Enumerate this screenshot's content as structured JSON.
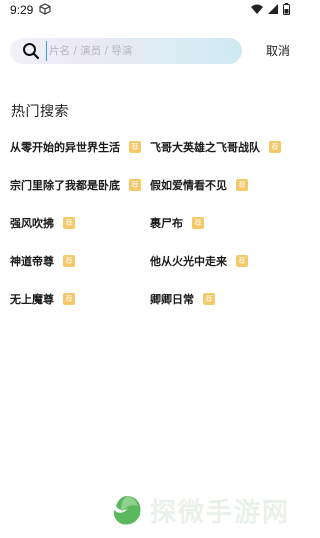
{
  "status_bar": {
    "time": "9:29",
    "icons": [
      "app-cube-icon",
      "wifi-icon",
      "signal-icon",
      "battery-icon"
    ]
  },
  "search": {
    "placeholder": "片名 / 演员 / 导演",
    "value": "",
    "cancel_label": "取消"
  },
  "hot_search": {
    "title": "热门搜索",
    "badge_label": "荐",
    "badge_color": "#f5c86a",
    "items": [
      {
        "title": "从零开始的异世界生活"
      },
      {
        "title": "飞哥大英雄之飞哥战队"
      },
      {
        "title": "宗门里除了我都是卧底"
      },
      {
        "title": "假如爱情看不见"
      },
      {
        "title": "强风吹拂"
      },
      {
        "title": "裹尸布"
      },
      {
        "title": "神道帝尊"
      },
      {
        "title": "他从火光中走来"
      },
      {
        "title": "无上魔尊"
      },
      {
        "title": "卿卿日常"
      }
    ]
  },
  "watermark": {
    "text": "探微手游网",
    "logo_color": "#5cb85c"
  }
}
